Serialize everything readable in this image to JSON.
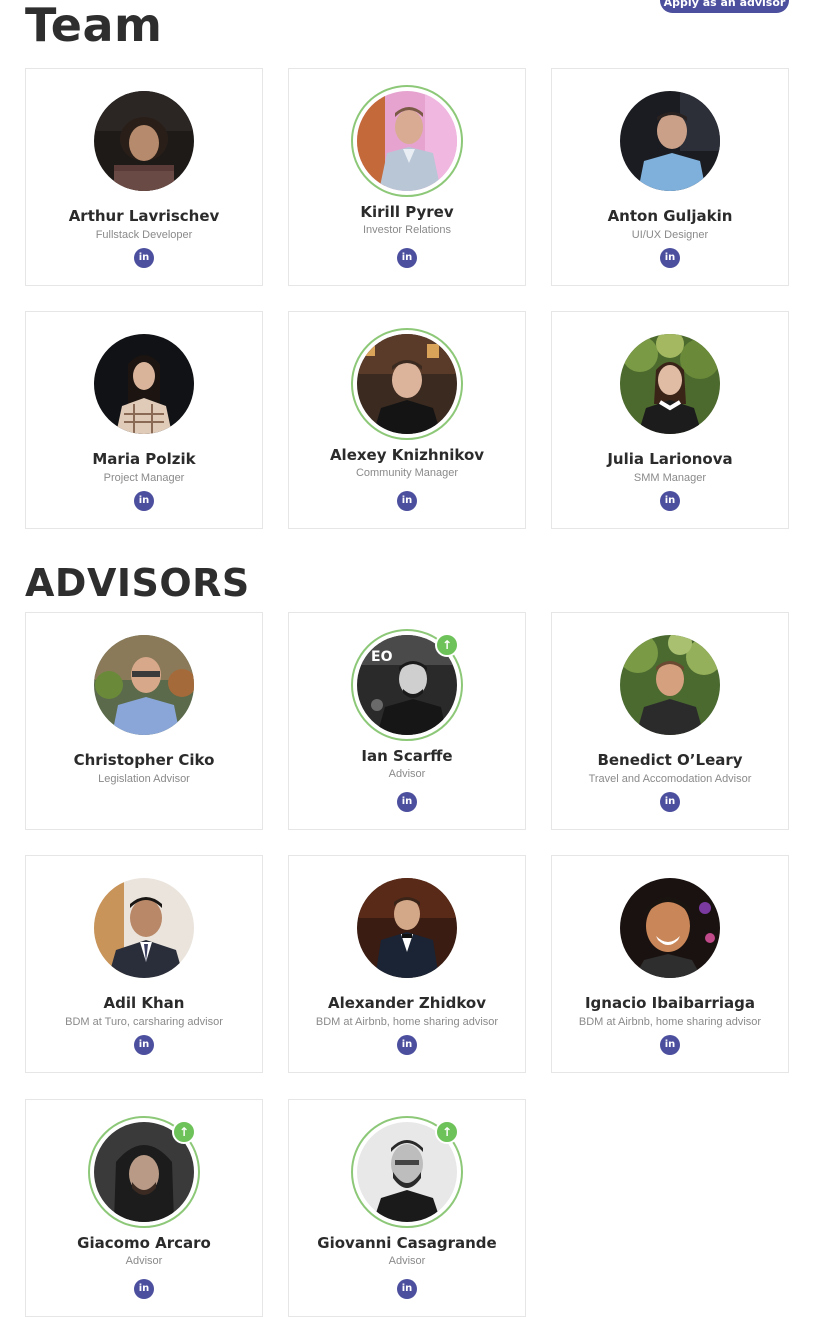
{
  "header": {
    "team_title": "Team",
    "apply_button": "Apply as an advisor",
    "advisors_title": "ADVISORS"
  },
  "team": [
    {
      "name": "Arthur Lavrischev",
      "role": "Fullstack Developer",
      "linkedin_icon": "in"
    },
    {
      "name": "Kirill Pyrev",
      "role": "Investor Relations",
      "linkedin_icon": "in"
    },
    {
      "name": "Anton Guljakin",
      "role": "UI/UX Designer",
      "linkedin_icon": "in"
    },
    {
      "name": "Maria Polzik",
      "role": "Project Manager",
      "linkedin_icon": "in"
    },
    {
      "name": "Alexey Knizhnikov",
      "role": "Community Manager",
      "linkedin_icon": "in"
    },
    {
      "name": "Julia Larionova",
      "role": "SMM Manager",
      "linkedin_icon": "in"
    }
  ],
  "advisors": [
    {
      "name": "Christopher Ciko",
      "role": "Legislation Advisor"
    },
    {
      "name": "Ian Scarffe",
      "role": "Advisor",
      "linkedin_icon": "in"
    },
    {
      "name": "Benedict O’Leary",
      "role": "Travel and Accomodation Advisor",
      "linkedin_icon": "in"
    },
    {
      "name": "Adil Khan",
      "role": "BDM at Turo, carsharing advisor",
      "linkedin_icon": "in"
    },
    {
      "name": "Alexander Zhidkov",
      "role": "BDM at Airbnb, home sharing advisor",
      "linkedin_icon": "in"
    },
    {
      "name": "Ignacio Ibaibarriaga",
      "role": "BDM at Airbnb, home sharing advisor",
      "linkedin_icon": "in"
    },
    {
      "name": "Giacomo Arcaro",
      "role": "Advisor",
      "linkedin_icon": "in"
    },
    {
      "name": "Giovanni Casagrande",
      "role": "Advisor",
      "linkedin_icon": "in"
    }
  ],
  "icons": {
    "upvote": "↑"
  },
  "colors": {
    "accent": "#4c4f9e",
    "ring": "#8dc878",
    "upvote": "#6ec25a"
  }
}
